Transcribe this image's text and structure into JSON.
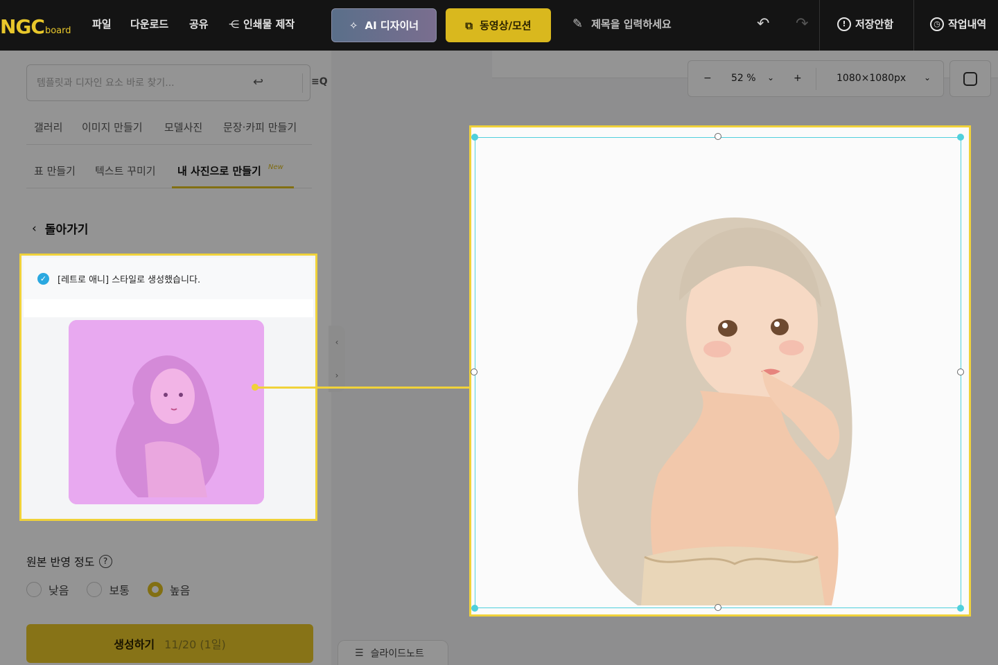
{
  "topbar": {
    "logo_main": "NGC",
    "logo_sub": "board",
    "menu": [
      "파일",
      "다운로드",
      "공유",
      "인쇄물 제작"
    ],
    "ai_designer": "AI 디자이너",
    "video_motion": "동영상/모션",
    "title_placeholder": "제목을 입력하세요",
    "unsaved": "저장안함",
    "history": "작업내역"
  },
  "search": {
    "placeholder": "템플릿과 디자인 요소 바로 찾기..."
  },
  "tabs_row1": [
    "갤러리",
    "이미지 만들기",
    "모델사진",
    "문장·카피 만들기"
  ],
  "tabs_row2": [
    "표 만들기",
    "텍스트 꾸미기",
    "내 사진으로 만들기"
  ],
  "new_badge": "New",
  "back_label": "돌아가기",
  "result_message": "[레트로 애니] 스타일로 생성했습니다.",
  "fidelity": {
    "label": "원본 반영 정도",
    "options": [
      "낮음",
      "보통",
      "높음"
    ],
    "selected": "높음"
  },
  "generate": {
    "label": "생성하기",
    "count": "11/20 (1일)"
  },
  "zoom": {
    "value": "52 %",
    "size": "1080×1080px"
  },
  "slide_note": "슬라이드노트",
  "colors": {
    "accent": "#e8c629",
    "selection": "#4fd0dc",
    "thumb_bg": "#e8a9f0"
  }
}
